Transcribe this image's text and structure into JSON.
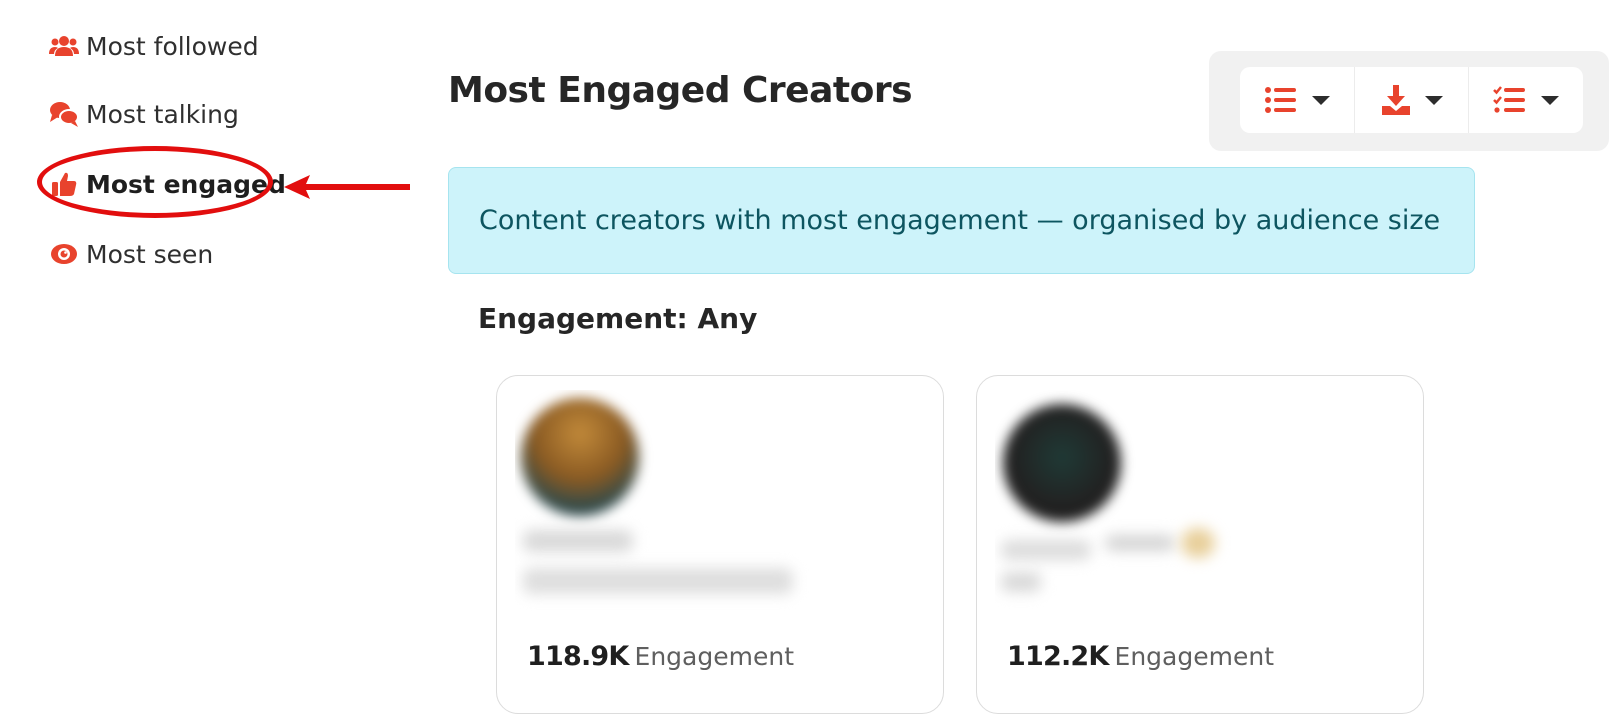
{
  "sidebar": {
    "items": [
      {
        "label": "Most followed",
        "icon": "users-icon"
      },
      {
        "label": "Most talking",
        "icon": "comments-icon"
      },
      {
        "label": "Most engaged",
        "icon": "thumbs-up-icon",
        "active": true
      },
      {
        "label": "Most seen",
        "icon": "eye-icon"
      }
    ]
  },
  "page": {
    "title": "Most Engaged Creators",
    "banner": "Content creators with most engagement — organised by audience size",
    "filter_label": "Engagement: Any"
  },
  "toolbar": {
    "buttons": [
      {
        "icon": "list-icon"
      },
      {
        "icon": "download-icon"
      },
      {
        "icon": "checklist-icon"
      }
    ]
  },
  "cards": [
    {
      "value": "118.9K",
      "metric": "Engagement"
    },
    {
      "value": "112.2K",
      "metric": "Engagement"
    }
  ],
  "colors": {
    "accent": "#e8432d",
    "banner_bg": "#cdf3fa",
    "banner_text": "#0d5560",
    "annotation": "#e20e0e"
  }
}
